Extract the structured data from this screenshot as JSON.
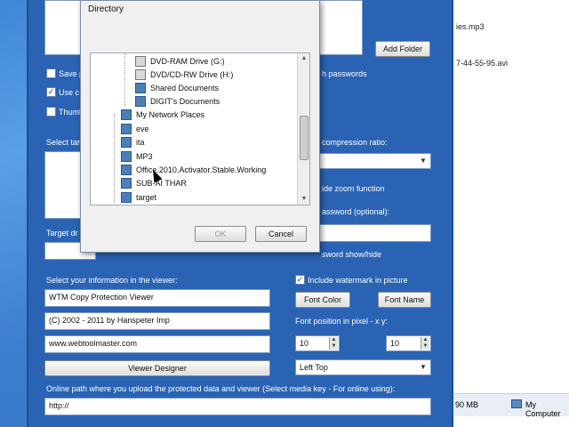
{
  "explorer": {
    "files": [
      "ies.mp3",
      "7-44-55-95.avi"
    ],
    "status_size": "90 MB",
    "status_computer": "My Computer"
  },
  "app": {
    "add_folder": "Add Folder",
    "save_label": "Save p",
    "use_label": "Use c",
    "thumb_label": "Thumb",
    "passwords_label": "h passwords",
    "select_target_label": "Select tar",
    "compression_label": "compression ratio:",
    "zoom_label": "ide zoom function",
    "password_optional_label": "assword (optional):",
    "target_dir_label": "Target dr",
    "password_show_label": "sword show/hide",
    "viewer_info_label": "Select your information in the viewer:",
    "viewer_name": "WTM Copy Protection Viewer",
    "copyright": "(C) 2002 - 2011 by Hanspeter Imp",
    "website": "www.webtoolmaster.com",
    "viewer_designer": "Viewer Designer",
    "watermark_label": "Include watermark in picture",
    "font_color": "Font Color",
    "font_name": "Font Name",
    "font_position_label": "Font position in pixel - x y:",
    "pos_x": "10",
    "pos_y": "10",
    "position_select": "Left Top",
    "online_path_label": "Online path where you upload the protected data and viewer (Select media key - For online using):",
    "online_path": "http://"
  },
  "dialog": {
    "title": "Directory",
    "ok": "OK",
    "cancel": "Cancel",
    "tree": [
      {
        "label": "DVD-RAM Drive (G:)",
        "icon": "drive-icon"
      },
      {
        "label": "DVD/CD-RW Drive (H:)",
        "icon": "drive-icon"
      },
      {
        "label": "Shared Documents",
        "icon": "folder-icon"
      },
      {
        "label": "DIGIT's Documents",
        "icon": "folder-icon"
      },
      {
        "label": "My Network Places",
        "icon": "network-icon"
      },
      {
        "label": "eve",
        "icon": "folder-icon"
      },
      {
        "label": "ita",
        "icon": "folder-icon"
      },
      {
        "label": "MP3",
        "icon": "folder-icon"
      },
      {
        "label": "Office.2010.Activator.Stable.Working",
        "icon": "folder-icon"
      },
      {
        "label": "SUB-AI THAR",
        "icon": "folder-icon"
      },
      {
        "label": "target",
        "icon": "folder-icon"
      }
    ]
  }
}
